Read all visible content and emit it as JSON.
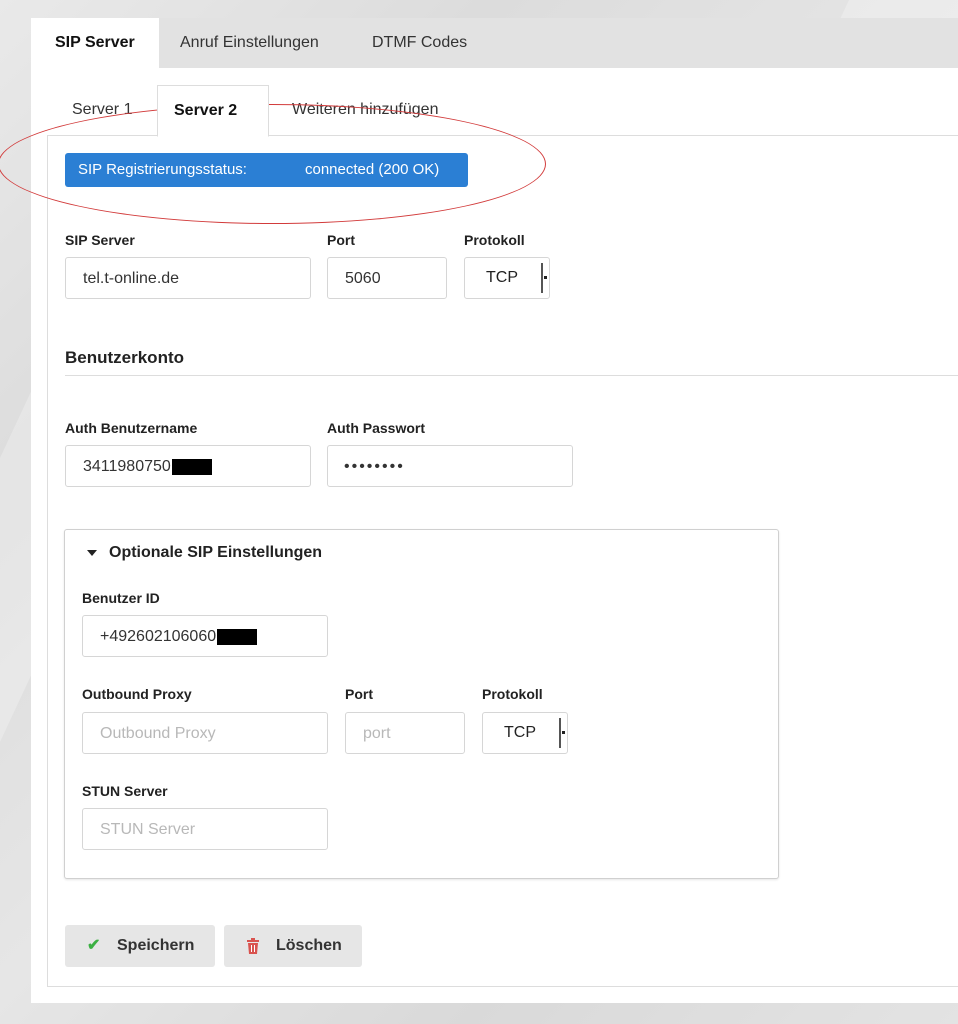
{
  "top_tabs": [
    {
      "label": "SIP Server",
      "active": true
    },
    {
      "label": "Anruf Einstellungen",
      "active": false
    },
    {
      "label": "DTMF Codes",
      "active": false
    }
  ],
  "server_tabs": [
    {
      "label": "Server 1",
      "active": false
    },
    {
      "label": "Server 2",
      "active": true
    },
    {
      "label": "Weiteren hinzufügen",
      "active": false
    }
  ],
  "status": {
    "label": "SIP Registrierungsstatus:",
    "value": "connected (200 OK)",
    "color": "#2b7fd4"
  },
  "annotation": {
    "shape": "ellipse",
    "color": "#d23b3b"
  },
  "server_fields": {
    "sip_server_label": "SIP Server",
    "sip_server_value": "tel.t-online.de",
    "port_label": "Port",
    "port_value": "5060",
    "protocol_label": "Protokoll",
    "protocol_value": "TCP"
  },
  "account": {
    "section_title": "Benutzerkonto",
    "auth_user_label": "Auth Benutzername",
    "auth_user_value": "3411980750",
    "auth_pass_label": "Auth Passwort",
    "auth_pass_value": "••••••••"
  },
  "optional": {
    "title": "Optionale SIP Einstellungen",
    "user_id_label": "Benutzer ID",
    "user_id_value": "+492602106060",
    "proxy_label": "Outbound Proxy",
    "proxy_placeholder": "Outbound Proxy",
    "port_label": "Port",
    "port_placeholder": "port",
    "protocol_label": "Protokoll",
    "protocol_value": "TCP",
    "stun_label": "STUN Server",
    "stun_placeholder": "STUN Server"
  },
  "buttons": {
    "save_label": "Speichern",
    "save_icon": "check-icon",
    "save_icon_color": "#3cb043",
    "delete_label": "Löschen",
    "delete_icon": "trash-icon",
    "delete_icon_color": "#d9534f"
  }
}
